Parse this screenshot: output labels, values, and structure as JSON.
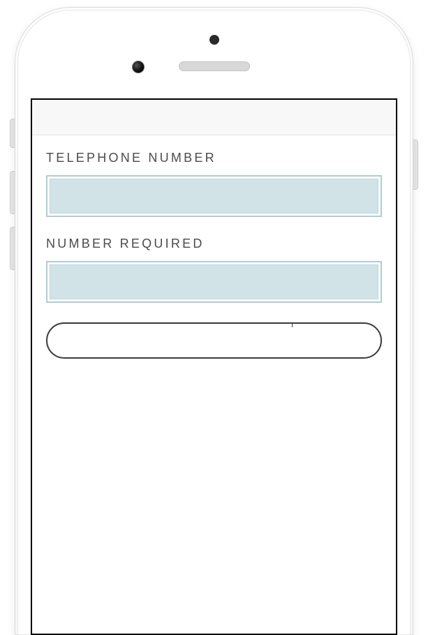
{
  "form": {
    "fields": [
      {
        "label": "TELEPHONE NUMBER",
        "value": ""
      },
      {
        "label": "NUMBER REQUIRED",
        "value": ""
      }
    ],
    "rounded_input": {
      "value": ""
    }
  }
}
